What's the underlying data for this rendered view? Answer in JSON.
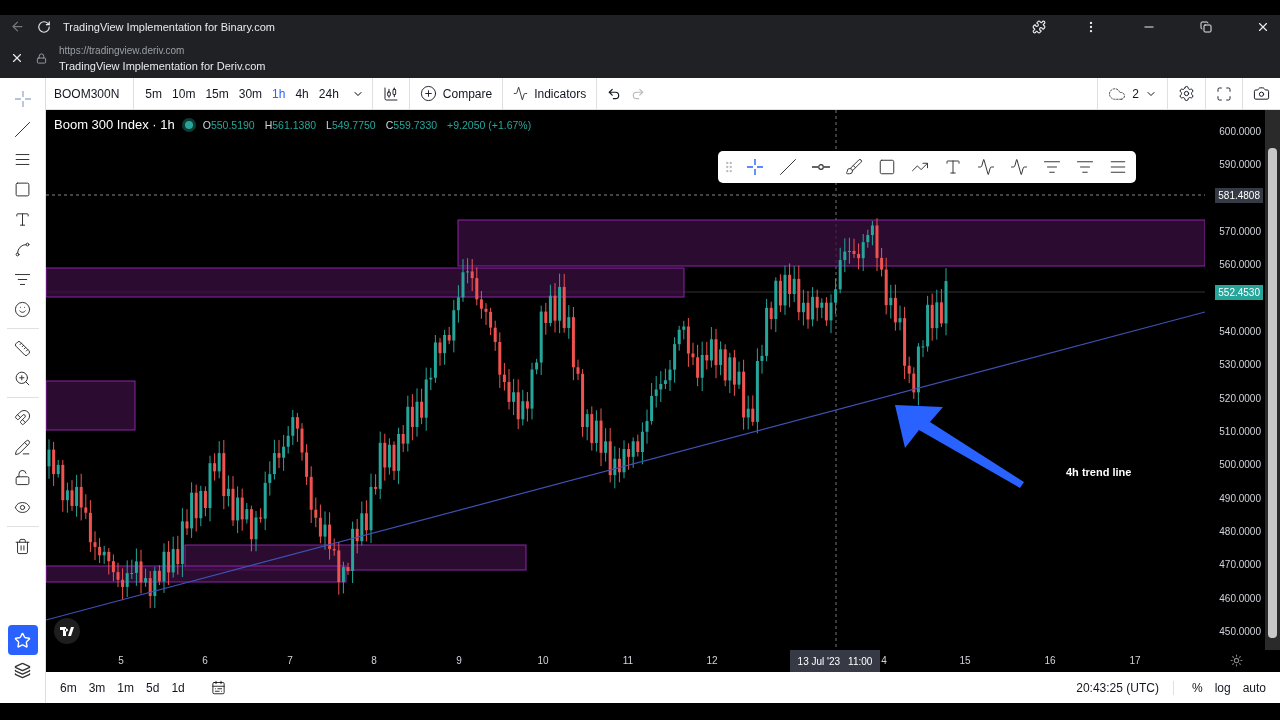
{
  "browser": {
    "tab_title": "TradingView Implementation for Binary.com",
    "url": "https://tradingview.deriv.com",
    "page_title": "TradingView Implementation for Deriv.com"
  },
  "toolbar": {
    "symbol": "BOOM300N",
    "intervals": [
      {
        "label": "5m",
        "selected": false
      },
      {
        "label": "10m",
        "selected": false
      },
      {
        "label": "15m",
        "selected": false
      },
      {
        "label": "30m",
        "selected": false
      },
      {
        "label": "1h",
        "selected": true
      },
      {
        "label": "4h",
        "selected": false
      },
      {
        "label": "24h",
        "selected": false
      }
    ],
    "compare": "Compare",
    "indicators": "Indicators",
    "layout_count": "2"
  },
  "legend": {
    "title": "Boom 300 Index · 1h",
    "ohlc": [
      {
        "label": "O",
        "value": "550.5190"
      },
      {
        "label": "H",
        "value": "561.1380"
      },
      {
        "label": "L",
        "value": "549.7750"
      },
      {
        "label": "C",
        "value": "559.7330"
      }
    ],
    "change": "+9.2050 (+1.67%)"
  },
  "drawing_toolbar": {
    "tools": [
      {
        "selected": true
      },
      {
        "selected": false
      },
      {
        "selected": false
      },
      {
        "selected": false
      },
      {
        "selected": false
      },
      {
        "selected": false
      },
      {
        "selected": false
      },
      {
        "selected": false
      },
      {
        "selected": false
      },
      {
        "selected": false
      },
      {
        "selected": false
      },
      {
        "selected": false
      }
    ]
  },
  "annotation": "4h trend line",
  "y_ticks": [
    "600.0000",
    "590.0000",
    "570.0000",
    "560.0000",
    "540.0000",
    "530.0000",
    "520.0000",
    "510.0000",
    "500.0000",
    "490.0000",
    "480.0000",
    "470.0000",
    "460.0000",
    "450.0000"
  ],
  "price_tags": [
    {
      "value": "581.4808",
      "kind": "crosshair"
    },
    {
      "value": "552.4530",
      "kind": "last"
    }
  ],
  "x_ticks": [
    "5",
    "6",
    "7",
    "8",
    "9",
    "10",
    "11",
    "12",
    "4",
    "15",
    "16",
    "17"
  ],
  "crosshair_label": {
    "date": "13 Jul '23",
    "time": "11:00"
  },
  "sidebar": {
    "favorites_selected": true
  },
  "bottom_bar": {
    "ranges": [
      "6m",
      "3m",
      "1m",
      "5d",
      "1d"
    ],
    "clock": "20:43:25 (UTC)",
    "options": [
      "%",
      "log",
      "auto"
    ]
  }
}
